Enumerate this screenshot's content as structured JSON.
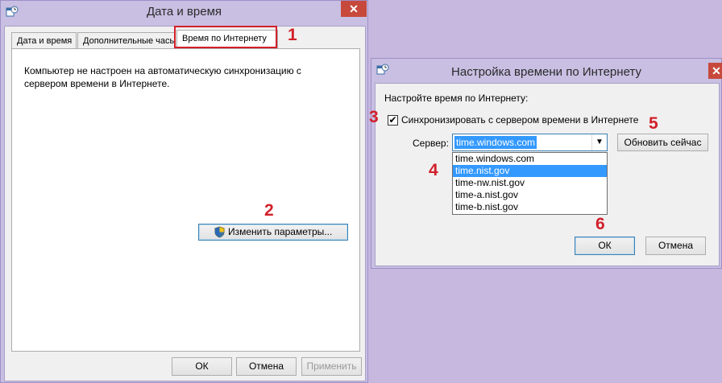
{
  "left_window": {
    "title": "Дата и время",
    "close_glyph": "✕",
    "tabs": [
      "Дата и время",
      "Дополнительные часы",
      "Время по Интернету"
    ],
    "message_line1": "Компьютер не настроен на автоматическую синхронизацию с",
    "message_line2": "сервером времени в Интернете.",
    "change_settings": "Изменить параметры...",
    "ok": "ОК",
    "cancel": "Отмена",
    "apply": "Применить"
  },
  "right_window": {
    "title": "Настройка времени по Интернету",
    "close_glyph": "✕",
    "heading": "Настройте время по Интернету:",
    "sync_checkbox_label": "Синхронизировать с сервером времени в Интернете",
    "sync_checked": true,
    "check_glyph": "✔",
    "server_label": "Сервер:",
    "server_value": "time.windows.com",
    "dropdown_arrow": "▼",
    "server_options": [
      "time.windows.com",
      "time.nist.gov",
      "time-nw.nist.gov",
      "time-a.nist.gov",
      "time-b.nist.gov"
    ],
    "selected_option": "time.nist.gov",
    "update_now": "Обновить сейчас",
    "ok": "ОК",
    "cancel": "Отмена"
  },
  "callouts": [
    "1",
    "2",
    "3",
    "4",
    "5",
    "6"
  ],
  "colors": {
    "callout": "#d2202a",
    "close": "#c7493c",
    "selection": "#3399ff",
    "desktop": "#c7b8e0"
  },
  "icons": {
    "app": "date-time-app-icon",
    "shield": "uac-shield-icon",
    "close": "close-icon",
    "chevron": "chevron-down-icon"
  }
}
